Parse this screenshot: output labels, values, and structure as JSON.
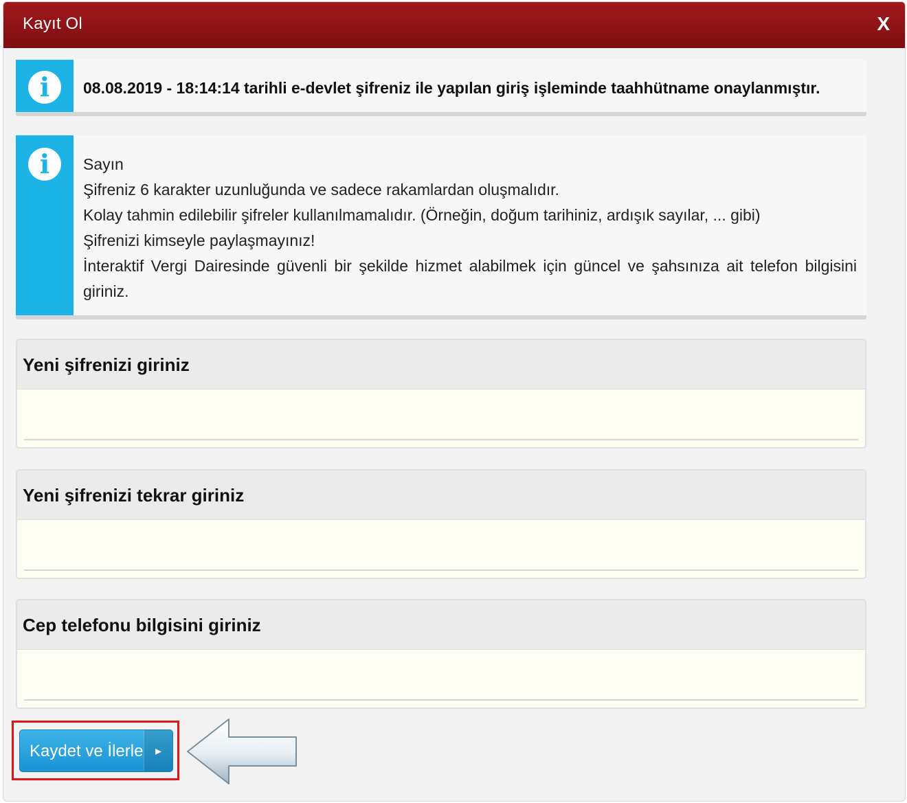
{
  "dialog": {
    "title": "Kayıt Ol",
    "close_label": "X"
  },
  "info_notice": {
    "icon": "info-icon",
    "text": "08.08.2019 - 18:14:14 tarihli e-devlet şifreniz ile yapılan giriş işleminde taahhütname onaylanmıştır."
  },
  "info_rules": {
    "icon": "info-icon",
    "greeting": "Sayın",
    "line1": "Şifreniz 6 karakter uzunluğunda ve sadece rakamlardan oluşmalıdır.",
    "line2": "Kolay tahmin edilebilir şifreler kullanılmamalıdır. (Örneğin, doğum tarihiniz, ardışık sayılar, ... gibi)",
    "line3": "Şifrenizi kimseyle paylaşmayınız!",
    "line4": "İnteraktif Vergi Dairesinde güvenli bir şekilde hizmet alabilmek için güncel ve şahsınıza ait telefon bilgisini giriniz."
  },
  "fields": {
    "new_password_label": "Yeni şifrenizi giriniz",
    "new_password_value": "",
    "repeat_password_label": "Yeni şifrenizi tekrar giriniz",
    "repeat_password_value": "",
    "phone_label": "Cep telefonu bilgisini giriniz",
    "phone_value": ""
  },
  "actions": {
    "save_label": "Kaydet ve İlerle",
    "save_arrow": "▸"
  },
  "colors": {
    "titlebar": "#8e1316",
    "info_accent": "#1cb4e6",
    "button": "#2aa3e0",
    "highlight": "#e01515"
  }
}
